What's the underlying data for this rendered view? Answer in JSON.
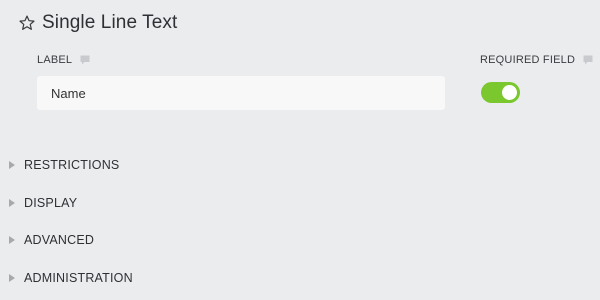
{
  "header": {
    "title": "Single Line Text",
    "favorite_icon": "star-outline-icon"
  },
  "fields": {
    "label": {
      "label": "LABEL",
      "value": "Name",
      "comment_icon": "comment-icon"
    },
    "required": {
      "label": "REQUIRED FIELD",
      "enabled": true,
      "comment_icon": "comment-icon"
    }
  },
  "sections": [
    {
      "label": "RESTRICTIONS",
      "expanded": false
    },
    {
      "label": "DISPLAY",
      "expanded": false
    },
    {
      "label": "ADVANCED",
      "expanded": false
    },
    {
      "label": "ADMINISTRATION",
      "expanded": false
    }
  ],
  "colors": {
    "background": "#ebecee",
    "toggle_on": "#7ac72e",
    "input_background": "#f8f8f8",
    "caret": "#a7a9ad",
    "comment_icon": "#c9cacd"
  }
}
